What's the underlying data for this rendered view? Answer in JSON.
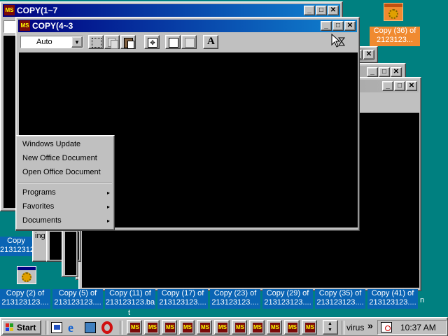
{
  "windows": {
    "win_back": {
      "title": "COPY(1~7"
    },
    "win_front": {
      "title": "COPY(4~3",
      "toolbar": {
        "font_select_value": "Auto"
      }
    }
  },
  "desktop_icons": [
    {
      "label_line1": "Copy (36) of",
      "label_line2": "2123123..."
    },
    {
      "label_line1": "Copy",
      "label_line2": "213123123..."
    },
    {
      "label_line1": "Copy (2) of",
      "label_line2": "213123123...."
    },
    {
      "label_line1": "Copy (5) of",
      "label_line2": "213123123...."
    },
    {
      "label_line1": "Copy (11) of",
      "label_line2": "213123123.ba"
    },
    {
      "label_line1": "Copy (17) of",
      "label_line2": "213123123...."
    },
    {
      "label_line1": "Copy (23) of",
      "label_line2": "213123123...."
    },
    {
      "label_line1": "Copy (29) of",
      "label_line2": "213123123...."
    },
    {
      "label_line1": "Copy (35) of",
      "label_line2": "213123123...."
    },
    {
      "label_line1": "Copy (41) of",
      "label_line2": "213123123...."
    }
  ],
  "desktop_fragments": {
    "ing_text": "ing",
    "t_text": "t",
    "n_text": "n"
  },
  "context_menu": {
    "items_top": [
      "Windows Update",
      "New Office Document",
      "Open Office Document"
    ],
    "items_bottom": [
      {
        "label": "Programs",
        "arrow": "▸"
      },
      {
        "label": "Favorites",
        "arrow": "▸"
      },
      {
        "label": "Documents",
        "arrow": "▸"
      }
    ]
  },
  "taskbar": {
    "start_label": "Start",
    "tray_label": "virus",
    "chevron": "»",
    "clock": "10:37 AM"
  },
  "icons": {
    "ms_icon_text": "MS"
  },
  "colors": {
    "desktop": "#008080",
    "titlebar_active": "#000080",
    "icon_label_bg": "#0a64b4",
    "selected_icon_bg": "#f08a30"
  }
}
